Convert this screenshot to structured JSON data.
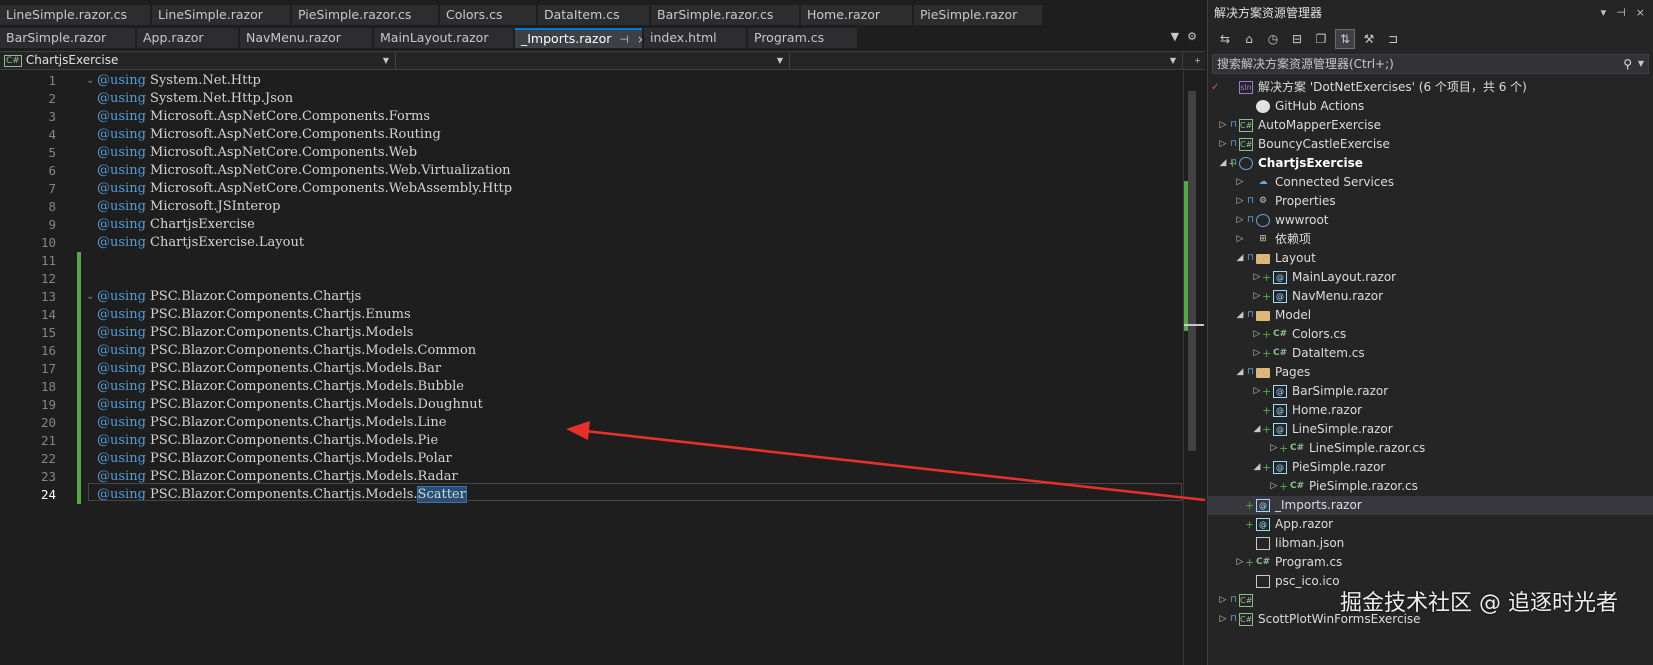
{
  "editor": {
    "tabs_row1": [
      "LineSimple.razor.cs",
      "LineSimple.razor",
      "PieSimple.razor.cs",
      "Colors.cs",
      "DataItem.cs",
      "BarSimple.razor.cs",
      "Home.razor",
      "PieSimple.razor"
    ],
    "tabs_row2": [
      "BarSimple.razor",
      "App.razor",
      "NavMenu.razor",
      "MainLayout.razor",
      "_Imports.razor",
      "index.html",
      "Program.cs"
    ],
    "active_tab": "_Imports.razor",
    "tab_pin_icon": "⊣",
    "tab_close_icon": "×",
    "nav_project": "ChartjsExercise",
    "nav_project_badge": "C#",
    "code_lines": [
      {
        "num": "1",
        "kw": "@using",
        "text": " System.Net.Http"
      },
      {
        "num": "2",
        "kw": "@using",
        "text": " System.Net.Http.Json"
      },
      {
        "num": "3",
        "kw": "@using",
        "text": " Microsoft.AspNetCore.Components.Forms"
      },
      {
        "num": "4",
        "kw": "@using",
        "text": " Microsoft.AspNetCore.Components.Routing"
      },
      {
        "num": "5",
        "kw": "@using",
        "text": " Microsoft.AspNetCore.Components.Web"
      },
      {
        "num": "6",
        "kw": "@using",
        "text": " Microsoft.AspNetCore.Components.Web.Virtualization"
      },
      {
        "num": "7",
        "kw": "@using",
        "text": " Microsoft.AspNetCore.Components.WebAssembly.Http"
      },
      {
        "num": "8",
        "kw": "@using",
        "text": " Microsoft.JSInterop"
      },
      {
        "num": "9",
        "kw": "@using",
        "text": " ChartjsExercise"
      },
      {
        "num": "10",
        "kw": "@using",
        "text": " ChartjsExercise.Layout"
      },
      {
        "num": "11",
        "kw": "",
        "text": ""
      },
      {
        "num": "12",
        "kw": "",
        "text": ""
      },
      {
        "num": "13",
        "kw": "@using",
        "text": " PSC.Blazor.Components.Chartjs"
      },
      {
        "num": "14",
        "kw": "@using",
        "text": " PSC.Blazor.Components.Chartjs.Enums"
      },
      {
        "num": "15",
        "kw": "@using",
        "text": " PSC.Blazor.Components.Chartjs.Models"
      },
      {
        "num": "16",
        "kw": "@using",
        "text": " PSC.Blazor.Components.Chartjs.Models.Common"
      },
      {
        "num": "17",
        "kw": "@using",
        "text": " PSC.Blazor.Components.Chartjs.Models.Bar"
      },
      {
        "num": "18",
        "kw": "@using",
        "text": " PSC.Blazor.Components.Chartjs.Models.Bubble"
      },
      {
        "num": "19",
        "kw": "@using",
        "text": " PSC.Blazor.Components.Chartjs.Models.Doughnut"
      },
      {
        "num": "20",
        "kw": "@using",
        "text": " PSC.Blazor.Components.Chartjs.Models.Line"
      },
      {
        "num": "21",
        "kw": "@using",
        "text": " PSC.Blazor.Components.Chartjs.Models.Pie"
      },
      {
        "num": "22",
        "kw": "@using",
        "text": " PSC.Blazor.Components.Chartjs.Models.Polar"
      },
      {
        "num": "23",
        "kw": "@using",
        "text": " PSC.Blazor.Components.Chartjs.Models.Radar"
      },
      {
        "num": "24",
        "kw": "@using",
        "text": " PSC.Blazor.Components.Chartjs.Models.",
        "selected": "Scatter"
      }
    ],
    "current_line": "24",
    "accent_color": "#007acc",
    "change_color": "#57a64a",
    "arrow_color": "#e8302a"
  },
  "solution_explorer": {
    "title": "解决方案资源管理器",
    "title_controls": [
      "▾",
      "⊣",
      "×"
    ],
    "search_placeholder": "搜索解决方案资源管理器(Ctrl+;)",
    "tree": [
      {
        "label": "解决方案 'DotNetExercises' (6 个项目，共 6 个)",
        "icon": "sln",
        "icon_text": "sln",
        "depth": 0,
        "exp": "",
        "check": true
      },
      {
        "label": "GitHub Actions",
        "icon": "github",
        "depth": 1,
        "exp": ""
      },
      {
        "label": "AutoMapperExercise",
        "icon": "csproj",
        "icon_text": "C#",
        "depth": 0,
        "exp": "▷",
        "lock": true
      },
      {
        "label": "BouncyCastleExercise",
        "icon": "csproj",
        "icon_text": "C#",
        "depth": 0,
        "exp": "▷",
        "lock": true
      },
      {
        "label": "ChartjsExercise",
        "icon": "globe",
        "depth": 0,
        "exp": "◢",
        "plus": true,
        "lock": true,
        "bold": true
      },
      {
        "label": "Connected Services",
        "icon": "cloud",
        "icon_text": "☁",
        "depth": 1,
        "exp": "▷"
      },
      {
        "label": "Properties",
        "icon": "props",
        "icon_text": "⚙",
        "depth": 1,
        "exp": "▷",
        "lock": true
      },
      {
        "label": "wwwroot",
        "icon": "globe",
        "depth": 1,
        "exp": "▷",
        "lock": true
      },
      {
        "label": "依赖项",
        "icon": "deps",
        "icon_text": "⊞",
        "depth": 1,
        "exp": "▷"
      },
      {
        "label": "Layout",
        "icon": "folder",
        "depth": 1,
        "exp": "◢",
        "lock": true
      },
      {
        "label": "MainLayout.razor",
        "icon": "razor",
        "icon_text": "@",
        "depth": 2,
        "exp": "▷",
        "plus": true
      },
      {
        "label": "NavMenu.razor",
        "icon": "razor",
        "icon_text": "@",
        "depth": 2,
        "exp": "▷",
        "plus": true
      },
      {
        "label": "Model",
        "icon": "folder",
        "depth": 1,
        "exp": "◢",
        "lock": true
      },
      {
        "label": "Colors.cs",
        "icon": "cs",
        "icon_text": "C#",
        "depth": 2,
        "exp": "▷",
        "plus": true
      },
      {
        "label": "DataItem.cs",
        "icon": "cs",
        "icon_text": "C#",
        "depth": 2,
        "exp": "▷",
        "plus": true
      },
      {
        "label": "Pages",
        "icon": "folder",
        "depth": 1,
        "exp": "◢",
        "lock": true
      },
      {
        "label": "BarSimple.razor",
        "icon": "razor",
        "icon_text": "@",
        "depth": 2,
        "exp": "▷",
        "plus": true
      },
      {
        "label": "Home.razor",
        "icon": "razor",
        "icon_text": "@",
        "depth": 2,
        "exp": "",
        "plus": true
      },
      {
        "label": "LineSimple.razor",
        "icon": "razor",
        "icon_text": "@",
        "depth": 2,
        "exp": "◢",
        "plus": true
      },
      {
        "label": "LineSimple.razor.cs",
        "icon": "cs",
        "icon_text": "C#",
        "depth": 3,
        "exp": "▷",
        "plus": true
      },
      {
        "label": "PieSimple.razor",
        "icon": "razor",
        "icon_text": "@",
        "depth": 2,
        "exp": "◢",
        "plus": true
      },
      {
        "label": "PieSimple.razor.cs",
        "icon": "cs",
        "icon_text": "C#",
        "depth": 3,
        "exp": "▷",
        "plus": true
      },
      {
        "label": "_Imports.razor",
        "icon": "razor",
        "icon_text": "@",
        "depth": 1,
        "exp": "",
        "plus": true,
        "selected": true
      },
      {
        "label": "App.razor",
        "icon": "razor",
        "icon_text": "@",
        "depth": 1,
        "exp": "",
        "plus": true
      },
      {
        "label": "libman.json",
        "icon": "file",
        "depth": 1,
        "exp": ""
      },
      {
        "label": "Program.cs",
        "icon": "cs",
        "icon_text": "C#",
        "depth": 1,
        "exp": "▷",
        "plus": true
      },
      {
        "label": "psc_ico.ico",
        "icon": "file",
        "depth": 1,
        "exp": ""
      },
      {
        "label": "",
        "icon": "csproj",
        "icon_text": "C#",
        "depth": 0,
        "exp": "▷",
        "lock": true
      },
      {
        "label": "ScottPlotWinFormsExercise",
        "icon": "csproj",
        "icon_text": "C#",
        "depth": 0,
        "exp": "▷",
        "lock": true
      }
    ]
  },
  "watermark": "掘金技术社区 @ 追逐时光者"
}
